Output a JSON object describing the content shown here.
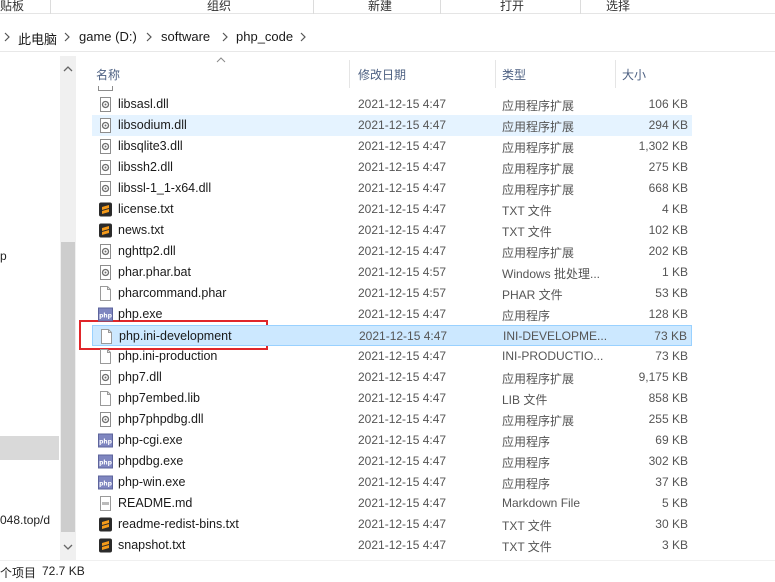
{
  "ribbon": {
    "groups": [
      "贴板",
      "组织",
      "新建",
      "打开",
      "选择"
    ]
  },
  "address": {
    "crumbs": [
      "此电脑",
      "game (D:)",
      "software",
      "php_code"
    ]
  },
  "navpane": {
    "partial_texts": [
      "p",
      "048.top/d"
    ]
  },
  "columns": {
    "name": "名称",
    "date": "修改日期",
    "type": "类型",
    "size": "大小"
  },
  "files": [
    {
      "name": "libsasl.dll",
      "date": "2021-12-15 4:47",
      "type": "应用程序扩展",
      "size": "106 KB",
      "icon": "dll-gear-icon"
    },
    {
      "name": "libsodium.dll",
      "date": "2021-12-15 4:47",
      "type": "应用程序扩展",
      "size": "294 KB",
      "icon": "dll-gear-icon"
    },
    {
      "name": "libsqlite3.dll",
      "date": "2021-12-15 4:47",
      "type": "应用程序扩展",
      "size": "1,302 KB",
      "icon": "dll-gear-icon"
    },
    {
      "name": "libssh2.dll",
      "date": "2021-12-15 4:47",
      "type": "应用程序扩展",
      "size": "275 KB",
      "icon": "dll-gear-icon"
    },
    {
      "name": "libssl-1_1-x64.dll",
      "date": "2021-12-15 4:47",
      "type": "应用程序扩展",
      "size": "668 KB",
      "icon": "dll-gear-icon"
    },
    {
      "name": "license.txt",
      "date": "2021-12-15 4:47",
      "type": "TXT 文件",
      "size": "4 KB",
      "icon": "sublime-text-icon"
    },
    {
      "name": "news.txt",
      "date": "2021-12-15 4:47",
      "type": "TXT 文件",
      "size": "102 KB",
      "icon": "sublime-text-icon"
    },
    {
      "name": "nghttp2.dll",
      "date": "2021-12-15 4:47",
      "type": "应用程序扩展",
      "size": "202 KB",
      "icon": "dll-gear-icon"
    },
    {
      "name": "phar.phar.bat",
      "date": "2021-12-15 4:57",
      "type": "Windows 批处理...",
      "size": "1 KB",
      "icon": "batch-gear-icon"
    },
    {
      "name": "pharcommand.phar",
      "date": "2021-12-15 4:57",
      "type": "PHAR 文件",
      "size": "53 KB",
      "icon": "blank-document-icon"
    },
    {
      "name": "php.exe",
      "date": "2021-12-15 4:47",
      "type": "应用程序",
      "size": "128 KB",
      "icon": "php-exe-icon"
    },
    {
      "name": "php.ini-development",
      "date": "2021-12-15 4:47",
      "type": "INI-DEVELOPME...",
      "size": "73 KB",
      "icon": "blank-document-icon"
    },
    {
      "name": "php.ini-production",
      "date": "2021-12-15 4:47",
      "type": "INI-PRODUCTIO...",
      "size": "73 KB",
      "icon": "blank-document-icon"
    },
    {
      "name": "php7.dll",
      "date": "2021-12-15 4:47",
      "type": "应用程序扩展",
      "size": "9,175 KB",
      "icon": "dll-gear-icon"
    },
    {
      "name": "php7embed.lib",
      "date": "2021-12-15 4:47",
      "type": "LIB 文件",
      "size": "858 KB",
      "icon": "blank-document-icon"
    },
    {
      "name": "php7phpdbg.dll",
      "date": "2021-12-15 4:47",
      "type": "应用程序扩展",
      "size": "255 KB",
      "icon": "dll-gear-icon"
    },
    {
      "name": "php-cgi.exe",
      "date": "2021-12-15 4:47",
      "type": "应用程序",
      "size": "69 KB",
      "icon": "php-exe-icon"
    },
    {
      "name": "phpdbg.exe",
      "date": "2021-12-15 4:47",
      "type": "应用程序",
      "size": "302 KB",
      "icon": "php-exe-icon"
    },
    {
      "name": "php-win.exe",
      "date": "2021-12-15 4:47",
      "type": "应用程序",
      "size": "37 KB",
      "icon": "php-exe-icon"
    },
    {
      "name": "README.md",
      "date": "2021-12-15 4:47",
      "type": "Markdown File",
      "size": "5 KB",
      "icon": "markdown-file-icon"
    },
    {
      "name": "readme-redist-bins.txt",
      "date": "2021-12-15 4:47",
      "type": "TXT 文件",
      "size": "30 KB",
      "icon": "sublime-text-icon"
    },
    {
      "name": "snapshot.txt",
      "date": "2021-12-15 4:47",
      "type": "TXT 文件",
      "size": "3 KB",
      "icon": "sublime-text-icon"
    }
  ],
  "status": {
    "count_label": "个项目",
    "selected_size": "72.7 KB"
  },
  "colors": {
    "hover_row": "#e5f3ff",
    "selected_row": "#cce8ff",
    "highlight_box": "#e0262a"
  }
}
